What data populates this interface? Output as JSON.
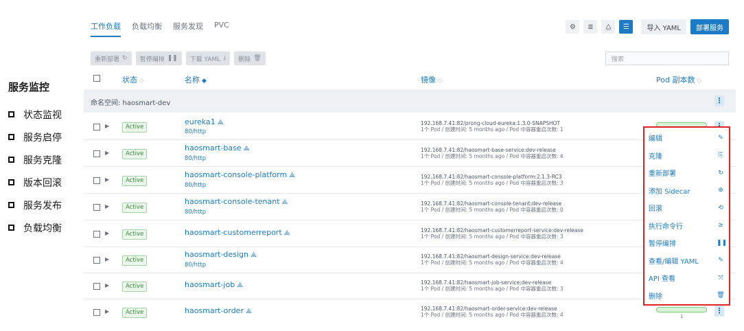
{
  "summary": {
    "title": "服务监控",
    "items": [
      "状态监视",
      "服务启停",
      "服务克隆",
      "版本回滚",
      "服务发布",
      "负载均衡"
    ]
  },
  "tabs": [
    {
      "label": "工作负载",
      "active": true
    },
    {
      "label": "负载均衡",
      "active": false
    },
    {
      "label": "服务发现",
      "active": false
    },
    {
      "label": "PVC",
      "active": false
    }
  ],
  "toolbar": {
    "import_label": "导入 YAML",
    "deploy_label": "部署服务"
  },
  "bulk_actions": [
    {
      "label": "重新部署",
      "icon": "↻"
    },
    {
      "label": "暂停编排",
      "icon": "❚❚"
    },
    {
      "label": "下载 YAML",
      "icon": "⤓"
    },
    {
      "label": "删除",
      "icon": "🗑"
    }
  ],
  "search": {
    "placeholder": "搜索"
  },
  "columns": {
    "status": "状态",
    "name": "名称",
    "image": "镜像",
    "pods": "Pod 副本数"
  },
  "namespace": {
    "label": "命名空间: haosmart-dev"
  },
  "rows": [
    {
      "status": "Active",
      "name": "eureka1",
      "port": "80/http",
      "image": "192.168.7.41:82/prong-cloud-eureka:1.3.0-SNAPSHOT",
      "meta": "1个 Pod / 创建时间: 5 months ago / Pod 中容器重启次数: 1"
    },
    {
      "status": "Active",
      "name": "haosmart-base",
      "port": "80/http",
      "image": "192.168.7.41:82/haosmart-base-service:dev-release",
      "meta": "1个 Pod / 创建时间: 5 months ago / Pod 中容器重启次数: 4"
    },
    {
      "status": "Active",
      "name": "haosmart-console-platform",
      "port": "80/http",
      "image": "192.168.7.41:82/haosmart-console-platform:2.1.3-RC3",
      "meta": "1个 Pod / 创建时间: 5 months ago / Pod 中容器重启次数: 3"
    },
    {
      "status": "Active",
      "name": "haosmart-console-tenant",
      "port": "80/http",
      "image": "192.168.7.41:82/haosmart-console-tenant:dev-release",
      "meta": "1个 Pod / 创建时间: 5 months ago / Pod 中容器重启次数: 0"
    },
    {
      "status": "Active",
      "name": "haosmart-customerreport",
      "port": "",
      "image": "192.168.7.41:82/haosmart-customerreport-service:dev-release",
      "meta": "1个 Pod / 创建时间: 5 months ago / Pod 中容器重启次数: 3"
    },
    {
      "status": "Active",
      "name": "haosmart-design",
      "port": "80/http",
      "image": "192.168.7.41:82/haosmart-design-service:dev-release",
      "meta": "1个 Pod / 创建时间: 5 months ago / Pod 中容器重启次数: 4"
    },
    {
      "status": "Active",
      "name": "haosmart-job",
      "port": "",
      "image": "192.168.7.41:82/haosmart-job-service:dev-release",
      "meta": "1个 Pod / 创建时间: 5 months ago / Pod 中容器重启次数: 3"
    },
    {
      "status": "Active",
      "name": "haosmart-order",
      "port": "",
      "image": "192.168.7.41:82/haosmart-order-service:dev-release",
      "meta": "1个 Pod / 创建时间: 5 months ago / Pod 中容器重启次数: 4"
    }
  ],
  "pods": {
    "last_row_count": "1"
  },
  "menu": [
    {
      "label": "编辑",
      "icon": "✎"
    },
    {
      "label": "克隆",
      "icon": "⎘"
    },
    {
      "label": "重新部署",
      "icon": "↻"
    },
    {
      "label": "添加 Sidecar",
      "icon": "⊕"
    },
    {
      "label": "回滚",
      "icon": "⟲"
    },
    {
      "label": "执行命令行",
      "icon": "≥"
    },
    {
      "label": "暂停编排",
      "icon": "❚❚"
    },
    {
      "label": "查看/编辑 YAML",
      "icon": "✎"
    },
    {
      "label": "API 查看",
      "icon": "⤧"
    },
    {
      "label": "删除",
      "icon": "🗑"
    }
  ],
  "colors": {
    "accent": "#1c7bc4",
    "highlight_border": "#e02424",
    "active_badge": "#3a8a3a"
  }
}
